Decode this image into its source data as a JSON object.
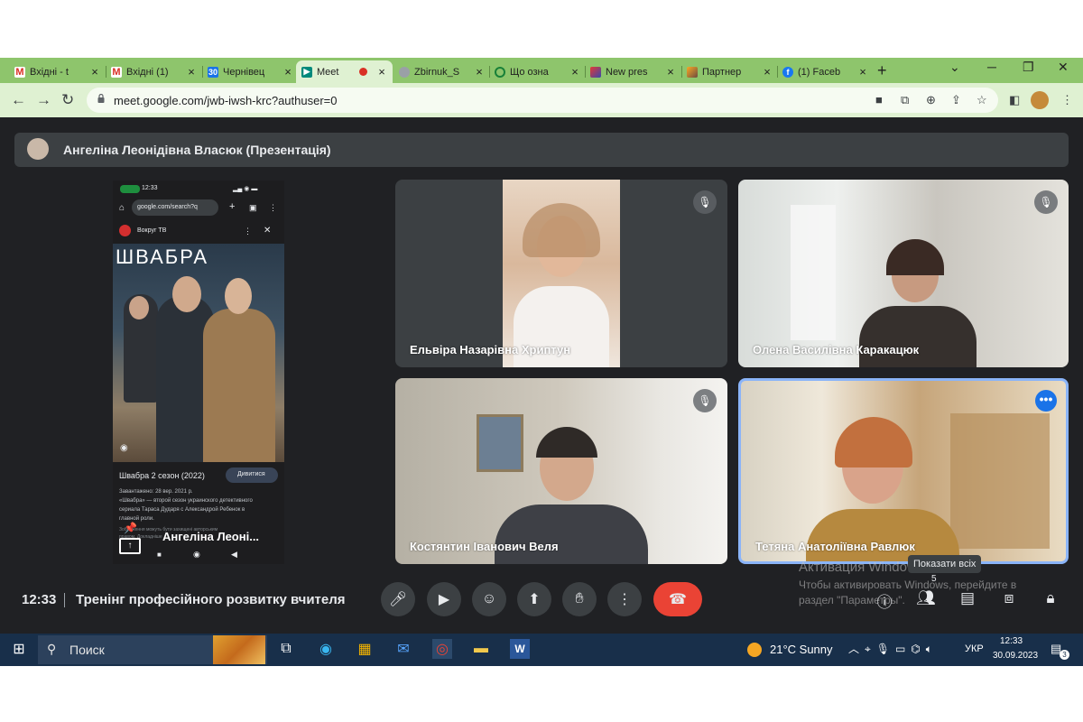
{
  "browser": {
    "tabs": [
      {
        "title": "Вхідні - t",
        "favicon": "gmail-icon",
        "active": false
      },
      {
        "title": "Вхідні (1)",
        "favicon": "gmail-icon",
        "active": false
      },
      {
        "title": "Чернівец",
        "favicon": "calendar-icon",
        "active": false
      },
      {
        "title": "Meet",
        "favicon": "meet-icon",
        "active": true
      },
      {
        "title": "Zbirnuk_S",
        "favicon": "globe-icon",
        "active": false
      },
      {
        "title": "Що озна",
        "favicon": "green-circle-icon",
        "active": false
      },
      {
        "title": "New pres",
        "favicon": "canva-icon",
        "active": false
      },
      {
        "title": "Партнер",
        "favicon": "partner-icon",
        "active": false
      },
      {
        "title": "(1) Faceb",
        "favicon": "facebook-icon",
        "active": false
      }
    ],
    "url": "meet.google.com/jwb-iwsh-krc?authuser=0"
  },
  "meet": {
    "presenter_title": "Ангеліна Леонідівна Власюк (Презентація)",
    "phone": {
      "status_time": "12:33",
      "search_url": "google.com/search?q",
      "site_name": "Вокруг ТВ",
      "poster_title": "ШВАБРА",
      "show_title": "Швабра 2 сезон (2022)",
      "watch_button": "Дивитися",
      "info_line1": "Завантажено: 28 вер. 2021 р.",
      "info_line2": "«Швабра» — второй сезон украинского детективного",
      "info_line3": "сериала Тараса Дударя с Александрой Ребенок в",
      "info_line4": "главной роли.",
      "info_line5": "Зображення можуть бути захищені авторським",
      "info_line6": "правом. Докладніше"
    },
    "presenter_name": "Ангеліна Леоні...",
    "participants": [
      {
        "name": "Ельвіра Назарівна Хриптун",
        "muted": true
      },
      {
        "name": "Олена Василівна Каракацюк",
        "muted": true
      },
      {
        "name": "Костянтин Іванович Веля",
        "muted": true
      },
      {
        "name": "Тетяна Анатоліївна Равлюк",
        "muted": false
      }
    ],
    "clock": "12:33",
    "meeting_name": "Тренінг професійного розвитку вчителя",
    "tooltip": "Показати всіх",
    "people_count": "5",
    "windows_activation": {
      "title": "Активация Windows",
      "line1": "Чтобы активировать Windows, перейдите в",
      "line2": "раздел \"Параметры\"."
    }
  },
  "taskbar": {
    "search_placeholder": "Поиск",
    "weather": "21°C  Sunny",
    "language": "УКР",
    "time": "12:33",
    "date": "30.09.2023",
    "notifications": "3"
  },
  "colors": {
    "tab_strip": "#8ec56c",
    "toolbar": "#dff1d2",
    "meet_bg": "#202124",
    "end_call": "#ea4335",
    "active_speaker": "#8ab4f8"
  }
}
